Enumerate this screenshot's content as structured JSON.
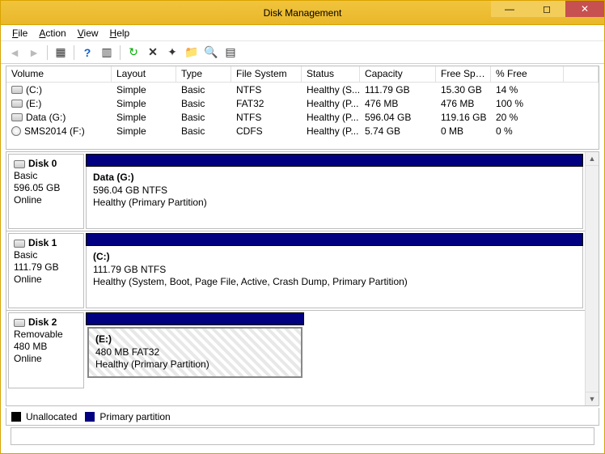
{
  "window": {
    "title": "Disk Management"
  },
  "menu": {
    "file": "File",
    "action": "Action",
    "view": "View",
    "help": "Help"
  },
  "columns": {
    "volume": "Volume",
    "layout": "Layout",
    "type": "Type",
    "fs": "File System",
    "status": "Status",
    "capacity": "Capacity",
    "free": "Free Spa...",
    "pct": "% Free"
  },
  "volumes": [
    {
      "name": "(C:)",
      "layout": "Simple",
      "type": "Basic",
      "fs": "NTFS",
      "status": "Healthy (S...",
      "capacity": "111.79 GB",
      "free": "15.30 GB",
      "pct": "14 %",
      "icon": "disk"
    },
    {
      "name": "(E:)",
      "layout": "Simple",
      "type": "Basic",
      "fs": "FAT32",
      "status": "Healthy (P...",
      "capacity": "476 MB",
      "free": "476 MB",
      "pct": "100 %",
      "icon": "disk"
    },
    {
      "name": "Data (G:)",
      "layout": "Simple",
      "type": "Basic",
      "fs": "NTFS",
      "status": "Healthy (P...",
      "capacity": "596.04 GB",
      "free": "119.16 GB",
      "pct": "20 %",
      "icon": "disk"
    },
    {
      "name": "SMS2014 (F:)",
      "layout": "Simple",
      "type": "Basic",
      "fs": "CDFS",
      "status": "Healthy (P...",
      "capacity": "5.74 GB",
      "free": "0 MB",
      "pct": "0 %",
      "icon": "cd"
    }
  ],
  "disks": [
    {
      "name": "Disk 0",
      "kind": "Basic",
      "size": "596.05 GB",
      "state": "Online",
      "vol": {
        "title": "Data  (G:)",
        "line2": "596.04 GB NTFS",
        "line3": "Healthy (Primary Partition)"
      }
    },
    {
      "name": "Disk 1",
      "kind": "Basic",
      "size": "111.79 GB",
      "state": "Online",
      "vol": {
        "title": "(C:)",
        "line2": "111.79 GB NTFS",
        "line3": "Healthy (System, Boot, Page File, Active, Crash Dump, Primary Partition)"
      }
    },
    {
      "name": "Disk 2",
      "kind": "Removable",
      "size": "480 MB",
      "state": "Online",
      "vol": {
        "title": "(E:)",
        "line2": "480 MB FAT32",
        "line3": "Healthy (Primary Partition)"
      }
    }
  ],
  "legend": {
    "unallocated": "Unallocated",
    "primary": "Primary partition"
  }
}
